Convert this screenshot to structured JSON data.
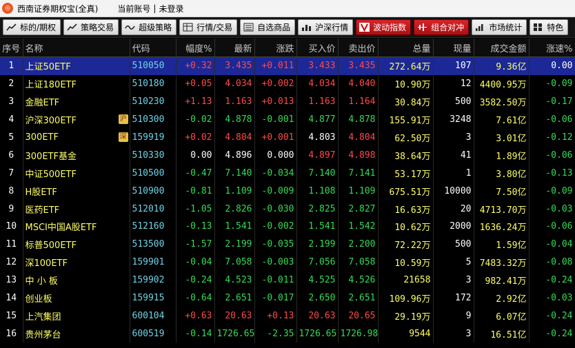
{
  "app": {
    "logo_glyph": "◎",
    "title": "西南证券期权宝(全真)",
    "account_label": "当前账号",
    "separator": "|",
    "login_status": "未登录"
  },
  "toolbar": [
    {
      "label": "标的/期权",
      "icon": "chart-icon",
      "style": "normal"
    },
    {
      "label": "策略交易",
      "icon": "chart-icon",
      "style": "normal"
    },
    {
      "label": "超级策略",
      "icon": "wave-icon",
      "style": "normal"
    },
    {
      "label": "行情/交易",
      "icon": "grid-icon",
      "style": "normal"
    },
    {
      "label": "自选商品",
      "icon": "list-icon",
      "style": "normal"
    },
    {
      "label": "沪深行情",
      "icon": "bars-icon",
      "style": "normal"
    },
    {
      "label": "波动指数",
      "icon": "v-icon",
      "style": "red"
    },
    {
      "label": "组合对冲",
      "icon": "hedge-icon",
      "style": "red"
    },
    {
      "label": "市场统计",
      "icon": "stats-icon",
      "style": "normal"
    },
    {
      "label": "特色",
      "icon": "feature-icon",
      "style": "normal"
    }
  ],
  "table": {
    "headers": [
      "序号",
      "名称",
      "代码",
      "幅度%",
      "最新",
      "涨跌",
      "买入价",
      "卖出价",
      "总量",
      "现量",
      "成交金额",
      "涨速%"
    ],
    "rows": [
      {
        "idx": "1",
        "name": "上证50ETF",
        "tag": "",
        "code": "510050",
        "pct": "+0.32",
        "last": "3.435",
        "chg": "+0.011",
        "bid": "3.433",
        "ask": "3.435",
        "vol": "272.64万",
        "cur": "107",
        "amt": "9.36亿",
        "spd": "0.00",
        "dir": "up",
        "bid_dir": "up",
        "ask_dir": "up",
        "spd_dir": "flat"
      },
      {
        "idx": "2",
        "name": "上证180ETF",
        "tag": "",
        "code": "510180",
        "pct": "+0.05",
        "last": "4.034",
        "chg": "+0.002",
        "bid": "4.034",
        "ask": "4.040",
        "vol": "10.90万",
        "cur": "12",
        "amt": "4400.95万",
        "spd": "-0.09",
        "dir": "up",
        "bid_dir": "up",
        "ask_dir": "up",
        "spd_dir": "down"
      },
      {
        "idx": "3",
        "name": "金融ETF",
        "tag": "",
        "code": "510230",
        "pct": "+1.13",
        "last": "1.163",
        "chg": "+0.013",
        "bid": "1.163",
        "ask": "1.164",
        "vol": "30.84万",
        "cur": "500",
        "amt": "3582.50万",
        "spd": "-0.17",
        "dir": "up",
        "bid_dir": "up",
        "ask_dir": "up",
        "spd_dir": "down"
      },
      {
        "idx": "4",
        "name": "沪深300ETF",
        "tag": "沪",
        "code": "510300",
        "pct": "-0.02",
        "last": "4.878",
        "chg": "-0.001",
        "bid": "4.877",
        "ask": "4.878",
        "vol": "155.91万",
        "cur": "3248",
        "amt": "7.61亿",
        "spd": "-0.06",
        "dir": "down",
        "bid_dir": "down",
        "ask_dir": "down",
        "spd_dir": "down"
      },
      {
        "idx": "5",
        "name": "300ETF",
        "tag": "深",
        "code": "159919",
        "pct": "+0.02",
        "last": "4.804",
        "chg": "+0.001",
        "bid": "4.803",
        "ask": "4.804",
        "vol": "62.50万",
        "cur": "3",
        "amt": "3.01亿",
        "spd": "-0.12",
        "dir": "up",
        "bid_dir": "flat",
        "ask_dir": "up",
        "spd_dir": "down"
      },
      {
        "idx": "6",
        "name": "300ETF基金",
        "tag": "",
        "code": "510330",
        "pct": "0.00",
        "last": "4.896",
        "chg": "0.000",
        "bid": "4.897",
        "ask": "4.898",
        "vol": "38.64万",
        "cur": "41",
        "amt": "1.89亿",
        "spd": "-0.06",
        "dir": "flat",
        "bid_dir": "up",
        "ask_dir": "up",
        "spd_dir": "down"
      },
      {
        "idx": "7",
        "name": "中证500ETF",
        "tag": "",
        "code": "510500",
        "pct": "-0.47",
        "last": "7.140",
        "chg": "-0.034",
        "bid": "7.140",
        "ask": "7.141",
        "vol": "53.17万",
        "cur": "1",
        "amt": "3.80亿",
        "spd": "-0.13",
        "dir": "down",
        "bid_dir": "down",
        "ask_dir": "down",
        "spd_dir": "down"
      },
      {
        "idx": "8",
        "name": "H股ETF",
        "tag": "",
        "code": "510900",
        "pct": "-0.81",
        "last": "1.109",
        "chg": "-0.009",
        "bid": "1.108",
        "ask": "1.109",
        "vol": "675.51万",
        "cur": "10000",
        "amt": "7.50亿",
        "spd": "-0.09",
        "dir": "down",
        "bid_dir": "down",
        "ask_dir": "down",
        "spd_dir": "down"
      },
      {
        "idx": "9",
        "name": "医药ETF",
        "tag": "",
        "code": "512010",
        "pct": "-1.05",
        "last": "2.826",
        "chg": "-0.030",
        "bid": "2.825",
        "ask": "2.827",
        "vol": "16.63万",
        "cur": "20",
        "amt": "4713.70万",
        "spd": "-0.03",
        "dir": "down",
        "bid_dir": "down",
        "ask_dir": "down",
        "spd_dir": "down"
      },
      {
        "idx": "10",
        "name": "MSCI中国A股ETF",
        "tag": "",
        "code": "512160",
        "pct": "-0.13",
        "last": "1.541",
        "chg": "-0.002",
        "bid": "1.541",
        "ask": "1.542",
        "vol": "10.62万",
        "cur": "2000",
        "amt": "1636.24万",
        "spd": "-0.06",
        "dir": "down",
        "bid_dir": "down",
        "ask_dir": "down",
        "spd_dir": "down"
      },
      {
        "idx": "11",
        "name": "标普500ETF",
        "tag": "",
        "code": "513500",
        "pct": "-1.57",
        "last": "2.199",
        "chg": "-0.035",
        "bid": "2.199",
        "ask": "2.200",
        "vol": "72.22万",
        "cur": "500",
        "amt": "1.59亿",
        "spd": "-0.04",
        "dir": "down",
        "bid_dir": "down",
        "ask_dir": "down",
        "spd_dir": "down"
      },
      {
        "idx": "12",
        "name": "深100ETF",
        "tag": "",
        "code": "159901",
        "pct": "-0.04",
        "last": "7.058",
        "chg": "-0.003",
        "bid": "7.056",
        "ask": "7.058",
        "vol": "10.59万",
        "cur": "5",
        "amt": "7483.32万",
        "spd": "-0.08",
        "dir": "down",
        "bid_dir": "down",
        "ask_dir": "down",
        "spd_dir": "down"
      },
      {
        "idx": "13",
        "name": "中 小 板",
        "tag": "",
        "code": "159902",
        "pct": "-0.24",
        "last": "4.523",
        "chg": "-0.011",
        "bid": "4.525",
        "ask": "4.526",
        "vol": "21658",
        "cur": "3",
        "amt": "982.41万",
        "spd": "-0.24",
        "dir": "down",
        "bid_dir": "down",
        "ask_dir": "down",
        "spd_dir": "down"
      },
      {
        "idx": "14",
        "name": "创业板",
        "tag": "",
        "code": "159915",
        "pct": "-0.64",
        "last": "2.651",
        "chg": "-0.017",
        "bid": "2.650",
        "ask": "2.651",
        "vol": "109.96万",
        "cur": "172",
        "amt": "2.92亿",
        "spd": "-0.03",
        "dir": "down",
        "bid_dir": "down",
        "ask_dir": "down",
        "spd_dir": "down"
      },
      {
        "idx": "15",
        "name": "上汽集团",
        "tag": "",
        "code": "600104",
        "pct": "+0.63",
        "last": "20.63",
        "chg": "+0.13",
        "bid": "20.63",
        "ask": "20.65",
        "vol": "29.19万",
        "cur": "9",
        "amt": "6.07亿",
        "spd": "-0.24",
        "dir": "up",
        "bid_dir": "up",
        "ask_dir": "up",
        "spd_dir": "down"
      },
      {
        "idx": "16",
        "name": "贵州茅台",
        "tag": "",
        "code": "600519",
        "pct": "-0.14",
        "last": "1726.65",
        "chg": "-2.35",
        "bid": "1726.65",
        "ask": "1726.98",
        "vol": "9544",
        "cur": "3",
        "amt": "16.51亿",
        "spd": "-0.24",
        "dir": "down",
        "bid_dir": "down",
        "ask_dir": "down",
        "spd_dir": "down"
      }
    ]
  },
  "colors": {
    "up": "#ff4a4a",
    "down": "#33dd55",
    "flat": "#ffffff",
    "selected_row": "#1c2896",
    "name_yellow": "#ffff66",
    "code_cyan": "#6ed4e8"
  }
}
